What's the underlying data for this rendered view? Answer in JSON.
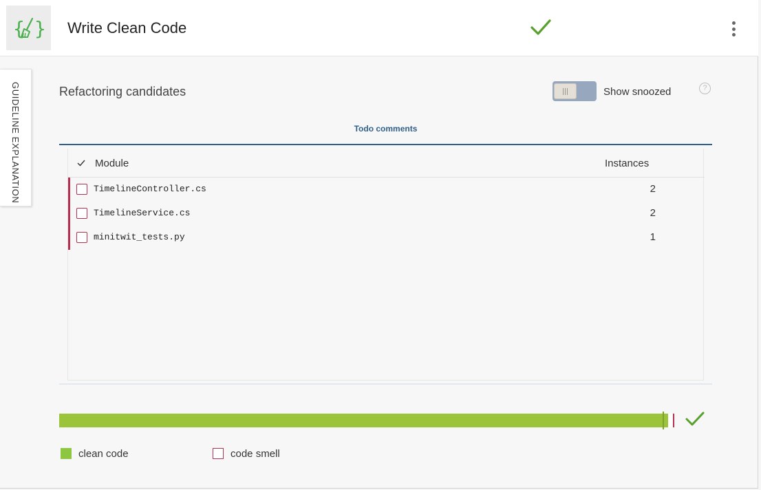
{
  "header": {
    "title": "Write Clean Code",
    "logo_icon": "curly-broom-icon",
    "status_icon": "check-icon",
    "menu_icon": "more-vertical-icon"
  },
  "side_tab": {
    "label": "GUIDELINE EXPLANATION"
  },
  "section": {
    "title": "Refactoring candidates",
    "show_snoozed_label": "Show snoozed",
    "show_snoozed_on": false,
    "help_icon": "help-circle-icon"
  },
  "tabs": [
    {
      "label": "Todo comments",
      "active": true
    }
  ],
  "table": {
    "columns": {
      "module": "Module",
      "instances": "Instances"
    },
    "rows": [
      {
        "module": "TimelineController.cs",
        "instances": "2"
      },
      {
        "module": "TimelineService.cs",
        "instances": "2"
      },
      {
        "module": "minitwit_tests.py",
        "instances": "1"
      }
    ]
  },
  "progress": {
    "clean_fraction": 0.99,
    "status_icon": "check-icon"
  },
  "legend": {
    "clean_label": "clean code",
    "smell_label": "code smell"
  },
  "colors": {
    "clean": "#8dc63f",
    "smell": "#b3304e",
    "accent": "#2f5f8a",
    "check": "#5aa02c"
  }
}
